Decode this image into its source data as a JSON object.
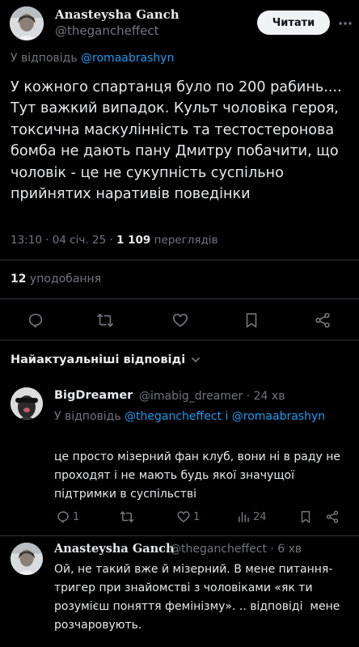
{
  "tweet": {
    "author_name": "Anasteysha Ganch",
    "author_handle": "@thegancheffect",
    "follow_label": "Читати",
    "reply_prefix": "У відповідь",
    "reply_to": "@romaabrashyn",
    "text": "У кожного спартанця було по 200 рабинь....\nТут важкий випадок. Культ чоловіка героя, токсична маскулінність та тестостеронова бомба не дають пану Дмитру побачити, що чоловік - це не сукупність суспільно прийнятих наративів поведінки",
    "time": "13:10 · 04 січ. 25 · ",
    "views_count": "1 109",
    "views_label": " переглядів",
    "likes_count": "12",
    "likes_label": " уподобання"
  },
  "replies_header": {
    "label": "Найактуальніші відповіді"
  },
  "replies": [
    {
      "name": "BigDreamer",
      "handle": "@imabig_dreamer · 24 хв",
      "reply_prefix": "У відповідь",
      "reply_to": "@thegancheffect і @romaabrashyn",
      "text": "це просто мізерний фан клуб, вони ні в раду не проходят і не мають будь якої значущої підтримки в суспільстві",
      "reply_count": "1",
      "like_count": "1",
      "view_count": "24"
    },
    {
      "name": "Anasteysha Ganch",
      "handle": "@thegancheffect · 6 хв",
      "text": "Ой, не такий вже й мізерний. В мене питання-тригер при знайомстві з чоловіками «як ти розумієш поняття фемінізму». .. відповіді  мене розчаровують."
    }
  ],
  "icons": {
    "more": "more-horizontal-icon",
    "reply": "reply-icon",
    "retweet": "retweet-icon",
    "like": "heart-icon",
    "bookmark": "bookmark-icon",
    "share": "share-icon",
    "views": "views-chart-icon",
    "chevron": "chevron-down-icon"
  },
  "colors": {
    "background": "#000000",
    "text": "#e7e9ea",
    "muted": "#71767b",
    "link": "#1d9bf0",
    "divider": "#2f3336"
  }
}
